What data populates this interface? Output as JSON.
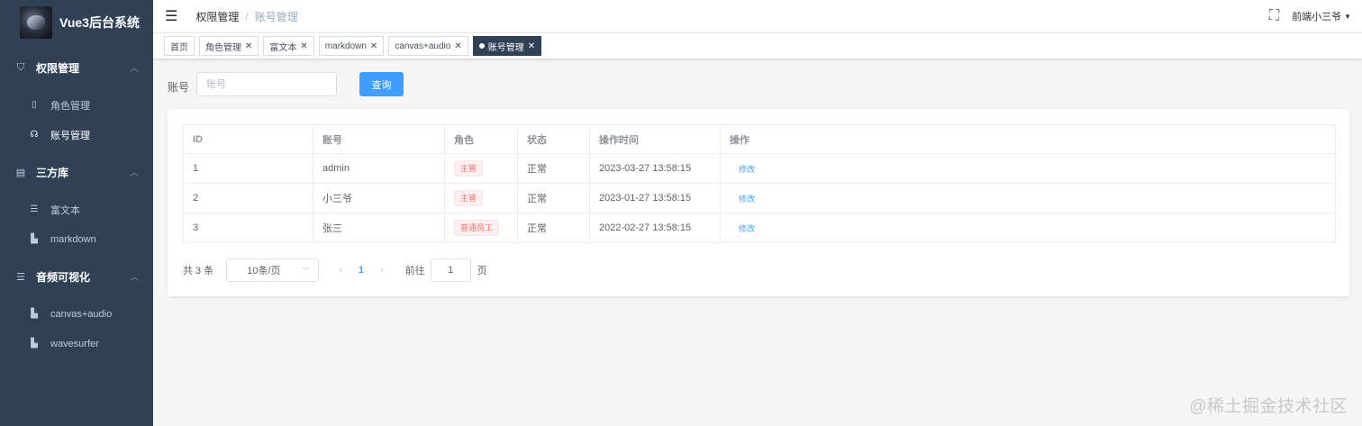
{
  "app": {
    "title": "Vue3后台系统"
  },
  "sidebar": {
    "groups": [
      {
        "label": "权限管理",
        "icon": "shield-icon",
        "items": [
          {
            "label": "角色管理",
            "icon": "id-card-icon",
            "active": false
          },
          {
            "label": "账号管理",
            "icon": "users-icon",
            "active": true
          }
        ]
      },
      {
        "label": "三方库",
        "icon": "clipboard-icon",
        "items": [
          {
            "label": "富文本",
            "icon": "list-icon",
            "active": false
          },
          {
            "label": "markdown",
            "icon": "document-icon",
            "active": false
          }
        ]
      },
      {
        "label": "音频可视化",
        "icon": "list-icon",
        "items": [
          {
            "label": "canvas+audio",
            "icon": "document-icon",
            "active": false
          },
          {
            "label": "wavesurfer",
            "icon": "document-icon",
            "active": false
          }
        ]
      }
    ]
  },
  "header": {
    "breadcrumb": [
      "权限管理",
      "账号管理"
    ],
    "breadcrumb_separator": "/",
    "user_name": "前端小三爷"
  },
  "tags": [
    {
      "label": "首页",
      "closable": false,
      "active": false
    },
    {
      "label": "角色管理",
      "closable": true,
      "active": false
    },
    {
      "label": "富文本",
      "closable": true,
      "active": false
    },
    {
      "label": "markdown",
      "closable": true,
      "active": false
    },
    {
      "label": "canvas+audio",
      "closable": true,
      "active": false
    },
    {
      "label": "账号管理",
      "closable": true,
      "active": true
    }
  ],
  "search": {
    "label": "账号",
    "placeholder": "账号",
    "value": "",
    "button_label": "查询"
  },
  "table": {
    "columns": [
      "ID",
      "账号",
      "角色",
      "状态",
      "操作时间",
      "操作"
    ],
    "rows": [
      {
        "id": "1",
        "account": "admin",
        "role": "主管",
        "status": "正常",
        "time": "2023-03-27 13:58:15",
        "action": "修改"
      },
      {
        "id": "2",
        "account": "小三爷",
        "role": "主管",
        "status": "正常",
        "time": "2023-01-27 13:58:15",
        "action": "修改"
      },
      {
        "id": "3",
        "account": "张三",
        "role": "普通员工",
        "status": "正常",
        "time": "2022-02-27 13:58:15",
        "action": "修改"
      }
    ]
  },
  "pagination": {
    "total_text": "共 3 条",
    "page_size": "10条/页",
    "current_page": "1",
    "goto_label": "前往",
    "goto_value": "1",
    "goto_unit": "页"
  },
  "watermark": "@稀土掘金技术社区",
  "colors": {
    "sidebar_bg": "#304156",
    "primary": "#409eff",
    "danger": "#f56c6c"
  }
}
